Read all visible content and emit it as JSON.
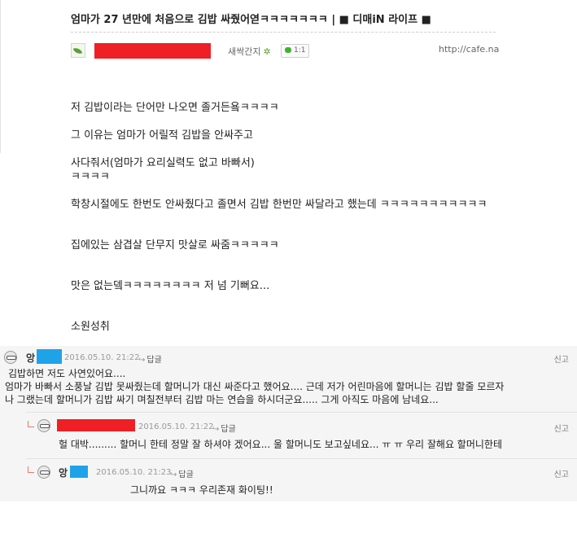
{
  "post": {
    "title": "엄마가 27 년만에 처음으로 김밥 싸줬어엳ㅋㅋㅋㅋㅋㅋㅋ",
    "board": " | ■ 디매iN 라이프 ■",
    "author_grade": "새싹간지",
    "comment_badge": "1:1",
    "url": "http://cafe.na",
    "colors": {
      "redaction": "#ee1f25",
      "blue_redaction": "#1fa3e8"
    },
    "body": [
      "저 김밥이라는 단어만 나오면 졸거든욬ㅋㅋㅋㅋ",
      "그 이유는 엄마가 어릴적 김밥을 안싸주고",
      "사다줘서(엄마가 요리실력도 없고 바빠서)",
      "ㅋㅋㅋㅋ",
      "학창시절에도 한번도 안싸줬다고 졸면서 김밥 한번만 싸달라고 했는데 ㅋㅋㅋㅋㅋㅋㅋㅋㅋㅋㅋ",
      "집에있는 삼겹살 단무지 맛살로 싸줌ㅋㅋㅋㅋㅋ",
      "맛은 없는뎈ㅋㅋㅋㅋㅋㅋㅋㅋ 저 넘 기뻐요...",
      "소원성취"
    ]
  },
  "comments": [
    {
      "name": "앙",
      "date": "2016.05.10. 21:22",
      "reply_label": "답글",
      "report_label": "신고",
      "lines": [
        "김밥하면 저도 사연있어요....",
        "엄마가 바빠서 소풍날 김밥 못싸줬는데 할머니가 대신 싸준다고 했어요.... 근데 저가 어린마음에 할머니는 김밥 할줄 모르자",
        "나 그랬는데 할머니가 김밥 싸기 며칠전부터 김밥 마는 연습을 하시더군요..... 그게 아직도 마음에 남네요..."
      ]
    },
    {
      "name": "",
      "date": "2016.05.10. 21:22",
      "reply_label": "답글",
      "report_label": "신고",
      "lines": [
        "헐 대박......... 할머니 한테 정말 잘 하셔야 겠어요... 울 할머니도 보고싶네요... ㅠ ㅠ 우리 잘해요 할머니한테"
      ]
    },
    {
      "name": "앙",
      "date": "2016.05.10. 21:23",
      "reply_label": "답글",
      "report_label": "신고",
      "lines": [
        "그니까요 ㅋㅋㅋ 우리존재 화이팅!!"
      ]
    }
  ]
}
